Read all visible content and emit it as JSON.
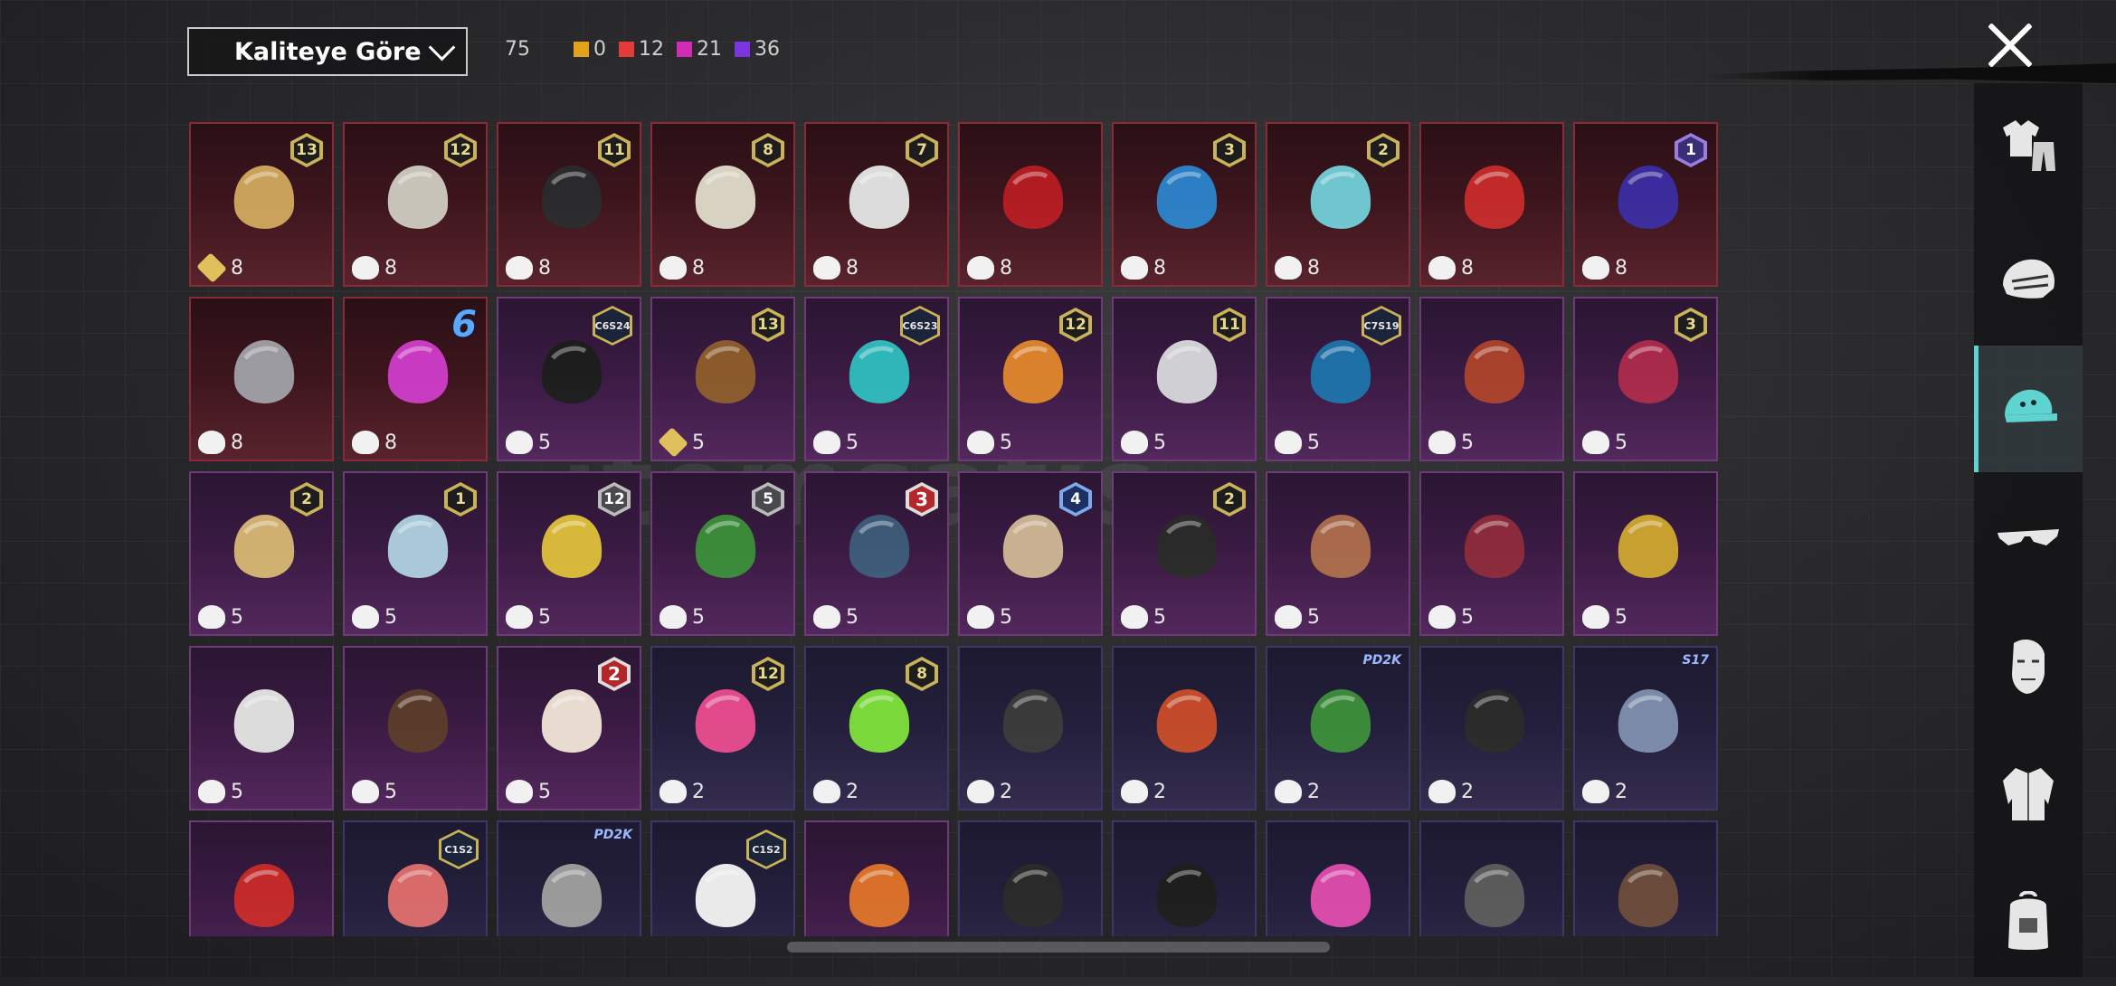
{
  "filter": {
    "sort_label": "Kaliteye Göre"
  },
  "counts": {
    "total": "75",
    "items": [
      {
        "color": "#e3a21a",
        "value": "0"
      },
      {
        "color": "#e33a3a",
        "value": "12"
      },
      {
        "color": "#d12bb8",
        "value": "21"
      },
      {
        "color": "#7a35e0",
        "value": "36"
      }
    ]
  },
  "watermark": "itemsatis",
  "sidebar": {
    "items": [
      {
        "icon": "outfit-icon"
      },
      {
        "icon": "mask-icon"
      },
      {
        "icon": "cap-icon",
        "active": true
      },
      {
        "icon": "glasses-icon"
      },
      {
        "icon": "face-icon"
      },
      {
        "icon": "jacket-icon"
      },
      {
        "icon": "backpack-icon"
      }
    ]
  },
  "inventory": {
    "rows": [
      [
        {
          "tier": "red",
          "badge": "13",
          "price": "8",
          "gold": true,
          "art": "#c9a15a"
        },
        {
          "tier": "red",
          "badge": "12",
          "price": "8",
          "art": "#c8c3b8"
        },
        {
          "tier": "red",
          "badge": "11",
          "price": "8",
          "art": "#2a2a2c"
        },
        {
          "tier": "red",
          "badge": "8",
          "price": "8",
          "art": "#d8d2c2"
        },
        {
          "tier": "red",
          "badge": "7",
          "price": "8",
          "art": "#dcdcdc"
        },
        {
          "tier": "red",
          "price": "8",
          "art": "#b11c22"
        },
        {
          "tier": "red",
          "badge": "3",
          "price": "8",
          "art": "#2c7fc4"
        },
        {
          "tier": "red",
          "badge": "2",
          "price": "8",
          "art": "#6fc6cf"
        },
        {
          "tier": "red",
          "price": "8",
          "art": "#c22a2a"
        },
        {
          "tier": "red",
          "badge": "1",
          "badgeStyle": "purple-b",
          "price": "8",
          "art": "#3a2c9c"
        }
      ],
      [
        {
          "tier": "red",
          "price": "8",
          "art": "#9a9aa0"
        },
        {
          "tier": "red",
          "big": "6",
          "price": "8",
          "art": "#c83ac0"
        },
        {
          "tier": "purple",
          "season": "C6S24",
          "price": "5",
          "art": "#1d1d1d"
        },
        {
          "tier": "purple",
          "badge": "13",
          "price": "5",
          "gold": true,
          "art": "#8a5a2c"
        },
        {
          "tier": "purple",
          "season": "C6S23",
          "price": "5",
          "art": "#2fb6b8"
        },
        {
          "tier": "purple",
          "badge": "12",
          "price": "5",
          "art": "#d9812c"
        },
        {
          "tier": "purple",
          "badge": "11",
          "price": "5",
          "art": "#cfcfd4"
        },
        {
          "tier": "purple",
          "season": "C7S19",
          "price": "5",
          "art": "#1e6fa6"
        },
        {
          "tier": "purple",
          "price": "5",
          "art": "#a8412c"
        },
        {
          "tier": "purple",
          "badge": "3",
          "price": "5",
          "art": "#a82a4a"
        }
      ],
      [
        {
          "tier": "purple",
          "badge": "2",
          "price": "5",
          "art": "#cfb070"
        },
        {
          "tier": "purple",
          "badge": "1",
          "price": "5",
          "art": "#a9c8d8"
        },
        {
          "tier": "purple",
          "badge": "12",
          "badgeStyle": "grey-b",
          "price": "5",
          "art": "#d8b83a"
        },
        {
          "tier": "purple",
          "badge": "5",
          "badgeStyle": "grey-b",
          "price": "5",
          "art": "#3a8a3a"
        },
        {
          "tier": "purple",
          "badge": "3",
          "badgeStyle": "red-b",
          "price": "5",
          "art": "#3c5a78"
        },
        {
          "tier": "purple",
          "badge": "4",
          "badgeStyle": "blue-b",
          "price": "5",
          "art": "#c8b090"
        },
        {
          "tier": "purple",
          "badge": "2",
          "price": "5",
          "art": "#2a2a2a"
        },
        {
          "tier": "purple",
          "price": "5",
          "art": "#a86a4a"
        },
        {
          "tier": "purple",
          "price": "5",
          "art": "#8a2a3a"
        },
        {
          "tier": "purple",
          "price": "5",
          "art": "#c8a030"
        }
      ],
      [
        {
          "tier": "purple",
          "price": "5",
          "art": "#dcdcdc"
        },
        {
          "tier": "purple",
          "price": "5",
          "art": "#5a3a2a"
        },
        {
          "tier": "purple",
          "badge": "2",
          "badgeStyle": "red-b",
          "price": "5",
          "art": "#e8dcd0"
        },
        {
          "tier": "blue",
          "badge": "12",
          "price": "2",
          "art": "#e04a8a"
        },
        {
          "tier": "blue",
          "badge": "8",
          "price": "2",
          "art": "#7ad83a"
        },
        {
          "tier": "blue",
          "price": "2",
          "art": "#3a3a3a"
        },
        {
          "tier": "blue",
          "price": "2",
          "art": "#c24a2a"
        },
        {
          "tier": "blue",
          "tag": "PD2K",
          "price": "2",
          "art": "#3a8a3a"
        },
        {
          "tier": "blue",
          "price": "2",
          "art": "#2a2a2a"
        },
        {
          "tier": "blue",
          "tag": "S17",
          "price": "2",
          "art": "#7a8aa8"
        }
      ],
      [
        {
          "tier": "purple",
          "art": "#c22a2a"
        },
        {
          "tier": "blue",
          "season": "C1S2",
          "art": "#d86a6a"
        },
        {
          "tier": "blue",
          "tag": "PD2K",
          "art": "#9a9a9a"
        },
        {
          "tier": "blue",
          "season": "C1S2",
          "art": "#eaeaea"
        },
        {
          "tier": "purple",
          "art": "#d8702a"
        },
        {
          "tier": "blue",
          "art": "#2a2a2a"
        },
        {
          "tier": "blue",
          "art": "#1e1e1e"
        },
        {
          "tier": "blue",
          "art": "#d84aa8"
        },
        {
          "tier": "blue",
          "art": "#5a5a5a"
        },
        {
          "tier": "blue",
          "art": "#6a4a3a"
        }
      ]
    ]
  }
}
